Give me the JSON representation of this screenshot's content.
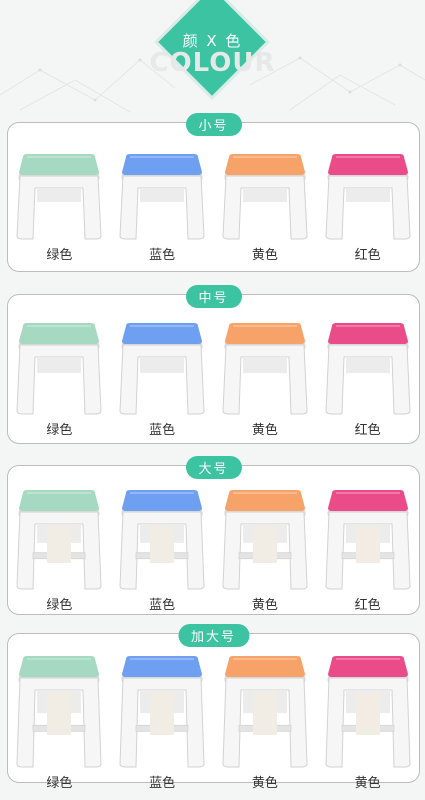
{
  "header": {
    "title_zh": "颜 X 色",
    "title_en": "COLOUR"
  },
  "colors": {
    "accent": "#3cc3a1",
    "green": "#a6d9c1",
    "blue": "#6f9ff0",
    "orange": "#f7a268",
    "red": "#ea4c8a"
  },
  "sections": [
    {
      "size": "small",
      "label": "小号",
      "items": [
        {
          "label": "绿色",
          "seat": "green"
        },
        {
          "label": "蓝色",
          "seat": "blue"
        },
        {
          "label": "黄色",
          "seat": "orange"
        },
        {
          "label": "红色",
          "seat": "red"
        }
      ]
    },
    {
      "size": "medium",
      "label": "中号",
      "items": [
        {
          "label": "绿色",
          "seat": "green"
        },
        {
          "label": "蓝色",
          "seat": "blue"
        },
        {
          "label": "黄色",
          "seat": "orange"
        },
        {
          "label": "红色",
          "seat": "red"
        }
      ]
    },
    {
      "size": "large",
      "label": "大号",
      "items": [
        {
          "label": "绿色",
          "seat": "green"
        },
        {
          "label": "蓝色",
          "seat": "blue"
        },
        {
          "label": "黄色",
          "seat": "orange"
        },
        {
          "label": "红色",
          "seat": "red"
        }
      ]
    },
    {
      "size": "xlarge",
      "label": "加大号",
      "items": [
        {
          "label": "绿色",
          "seat": "green"
        },
        {
          "label": "蓝色",
          "seat": "blue"
        },
        {
          "label": "黄色",
          "seat": "orange"
        },
        {
          "label": "黄色",
          "seat": "red"
        }
      ]
    }
  ]
}
